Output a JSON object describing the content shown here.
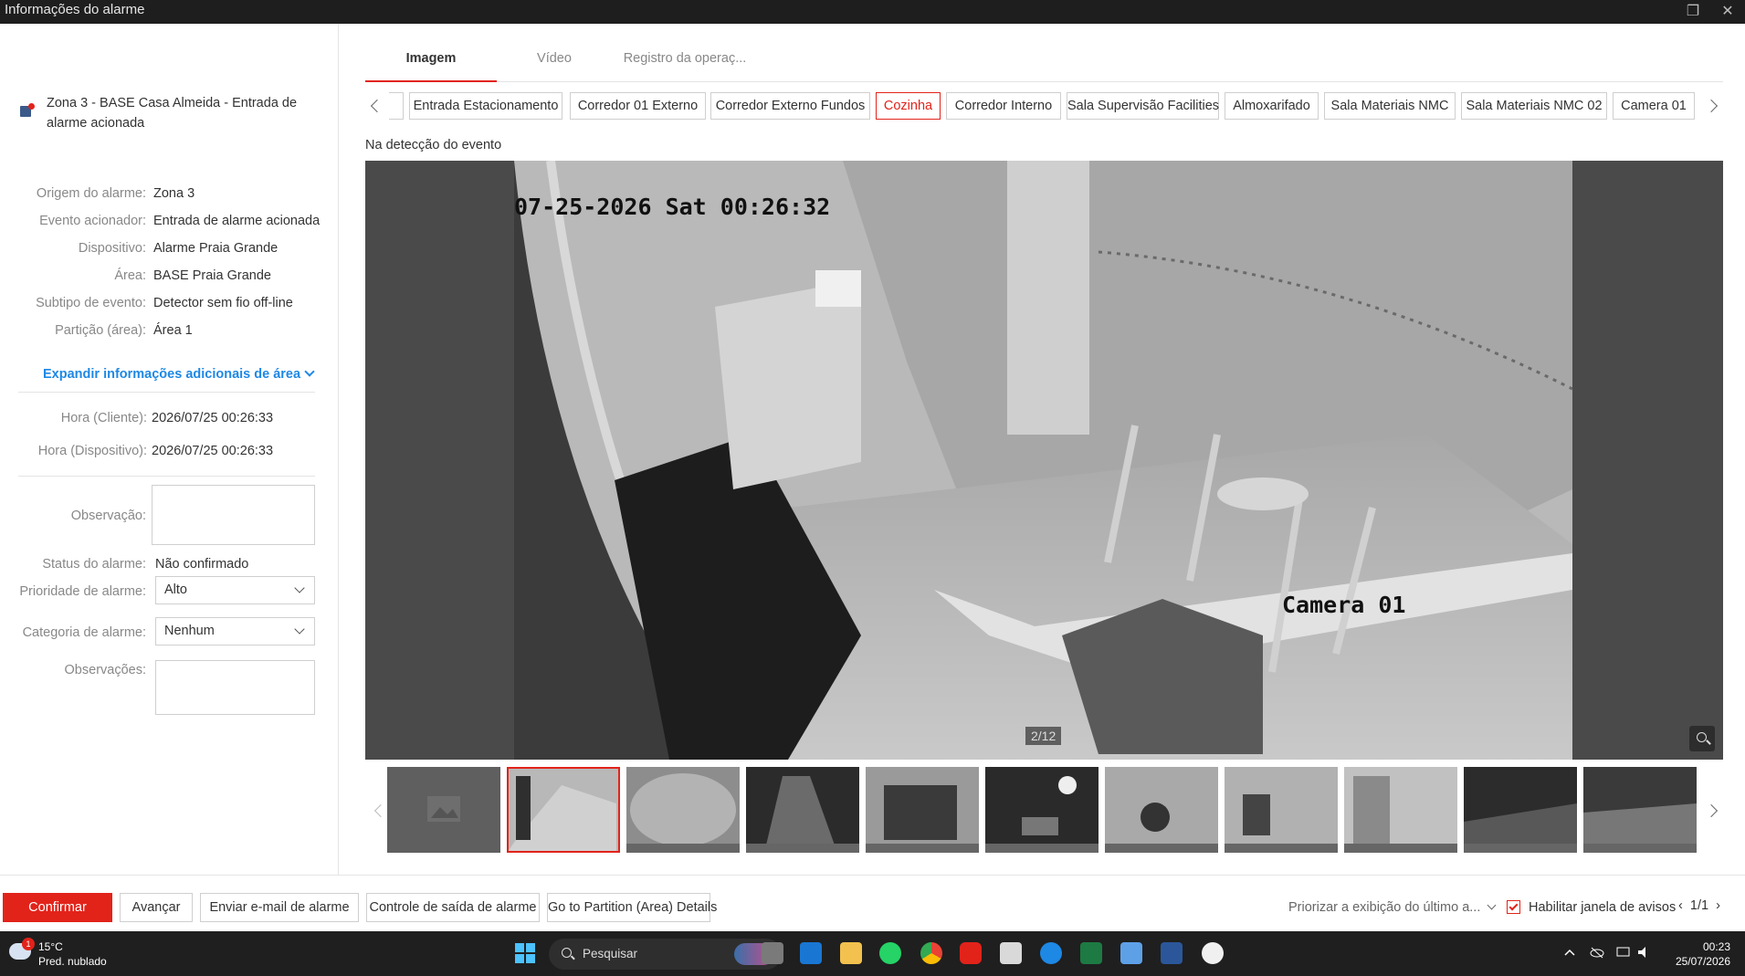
{
  "window": {
    "title": "Informações do alarme"
  },
  "alarm": {
    "heading": "Zona 3 - BASE Casa Almeida - Entrada de alarme acionada"
  },
  "details": [
    {
      "label": "Origem do alarme:",
      "value": "Zona 3"
    },
    {
      "label": "Evento acionador:",
      "value": "Entrada de alarme acionada"
    },
    {
      "label": "Dispositivo:",
      "value": "Alarme Praia Grande"
    },
    {
      "label": "Área:",
      "value": "BASE Praia Grande"
    },
    {
      "label": "Subtipo de evento:",
      "value": "Detector sem fio off-line"
    },
    {
      "label": "Partição (área):",
      "value": "Área 1"
    }
  ],
  "expand_label": "Expandir informações adicionais de área",
  "times": [
    {
      "label": "Hora (Cliente):",
      "value": "2026/07/25 00:26:33"
    },
    {
      "label": "Hora (Dispositivo):",
      "value": "2026/07/25 00:26:33"
    }
  ],
  "form": {
    "observacao_label": "Observação:",
    "status_label": "Status do alarme:",
    "status_value": "Não confirmado",
    "priority_label": "Prioridade de alarme:",
    "priority_value": "Alto",
    "category_label": "Categoria de alarme:",
    "category_value": "Nenhum",
    "notes_label": "Observações:"
  },
  "tabs": [
    {
      "label": "Imagem",
      "active": true
    },
    {
      "label": "Vídeo",
      "active": false
    },
    {
      "label": "Registro da operaç...",
      "active": false
    }
  ],
  "cameras": [
    {
      "label": "Entrada Estacionamento"
    },
    {
      "label": "Corredor 01 Externo"
    },
    {
      "label": "Corredor Externo Fundos"
    },
    {
      "label": "Cozinha",
      "selected": true
    },
    {
      "label": "Corredor Interno"
    },
    {
      "label": "Sala Supervisão Facilities"
    },
    {
      "label": "Almoxarifado"
    },
    {
      "label": "Sala Materiais NMC"
    },
    {
      "label": "Sala Materiais NMC 02"
    },
    {
      "label": "Camera 01"
    }
  ],
  "detection_label": "Na detecção do evento",
  "viewer": {
    "osd_timestamp": "07-25-2026 Sat 00:26:32",
    "osd_camera": "Camera 01",
    "counter": "2/12"
  },
  "actions": {
    "confirm": "Confirmar",
    "advance": "Avançar",
    "email": "Enviar e-mail de alarme",
    "output": "Controle de saída de alarme",
    "partition": "Go to Partition (Area) Details",
    "priority_display": "Priorizar a exibição do último a...",
    "enable_window": "Habilitar janela de avisos",
    "pager": "1/1"
  },
  "taskbar": {
    "weather_temp": "15°C",
    "weather_desc": "Pred. nublado",
    "weather_badge": "1",
    "search_placeholder": "Pesquisar",
    "time": "00:23",
    "date": "25/07/2026"
  },
  "colors": {
    "accent": "#e2231a",
    "link": "#1e88e5",
    "titlebar": "#1e1e1e",
    "taskbar": "#1f1f1f"
  }
}
